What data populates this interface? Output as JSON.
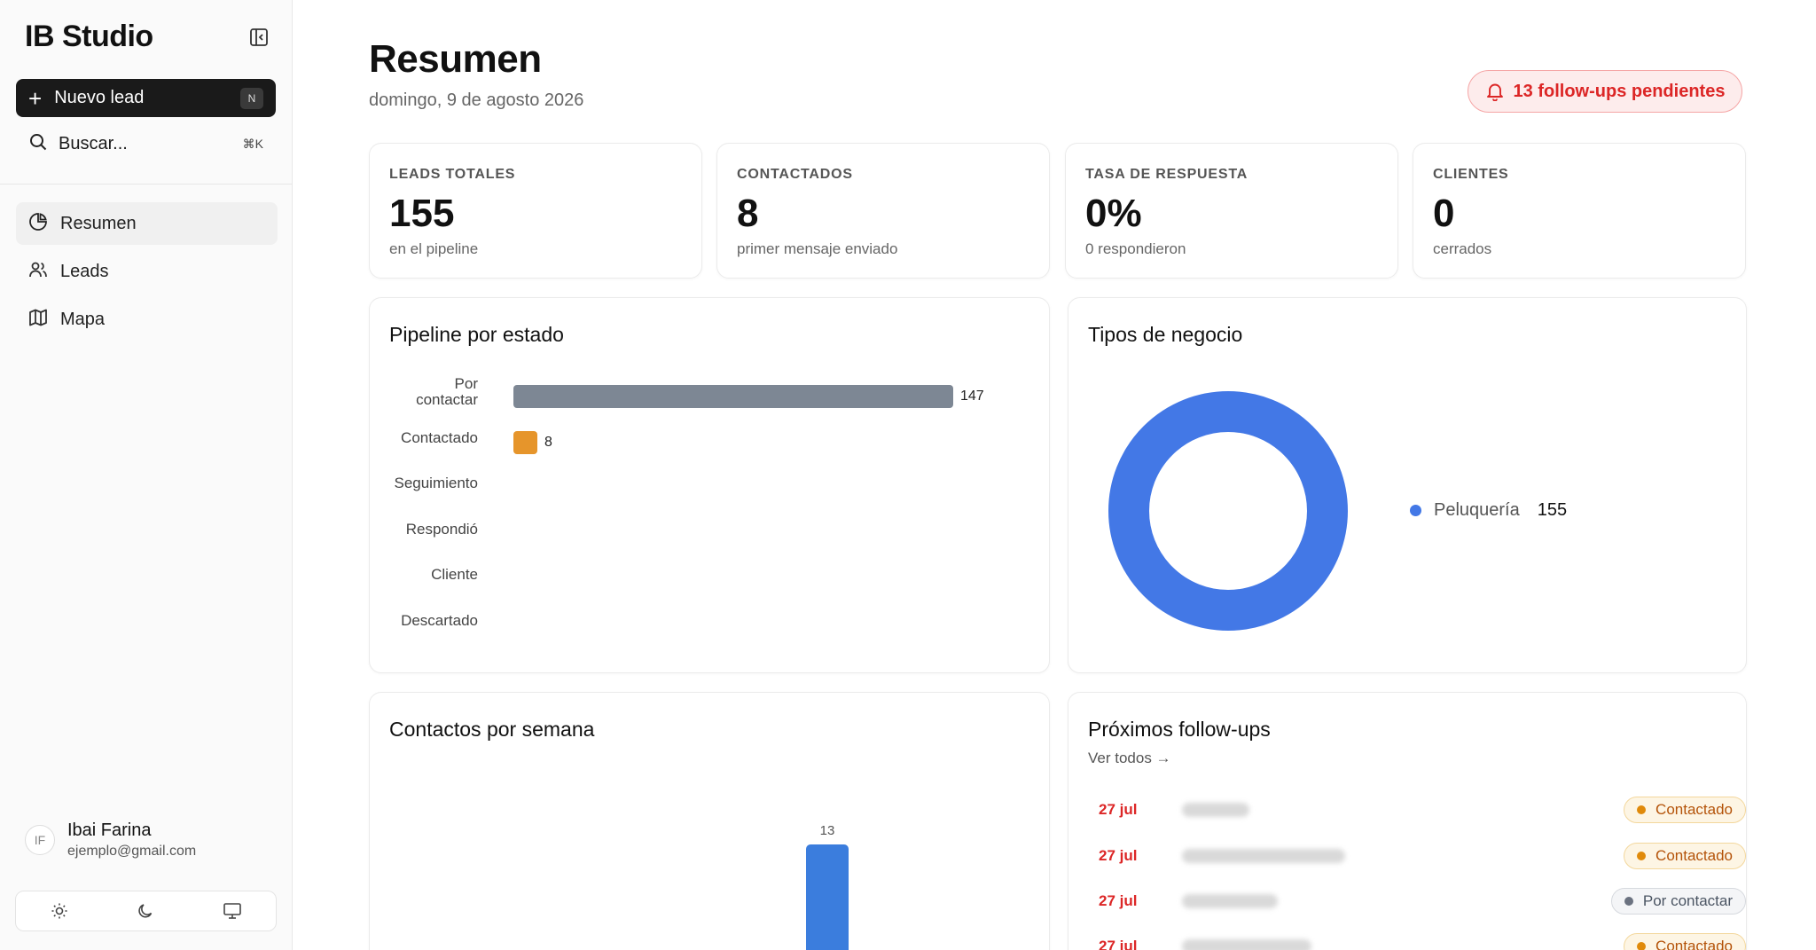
{
  "sidebar": {
    "brand": "IB Studio",
    "new_lead": {
      "label": "Nuevo lead",
      "shortcut": "N"
    },
    "search": {
      "label": "Buscar...",
      "shortcut": "⌘K"
    },
    "nav": [
      {
        "label": "Resumen",
        "icon": "pie-chart-icon",
        "active": true
      },
      {
        "label": "Leads",
        "icon": "users-icon",
        "active": false
      },
      {
        "label": "Mapa",
        "icon": "map-icon",
        "active": false
      }
    ],
    "user": {
      "initials": "IF",
      "name": "Ibai Farina",
      "email": "ejemplo@gmail.com"
    },
    "theme_buttons": [
      "sun-icon",
      "moon-icon",
      "monitor-icon"
    ]
  },
  "header": {
    "title": "Resumen",
    "date": "domingo, 9 de agosto 2026",
    "followups_alert": "13 follow-ups pendientes"
  },
  "stats": [
    {
      "label": "LEADS TOTALES",
      "value": "155",
      "sub": "en el pipeline"
    },
    {
      "label": "CONTACTADOS",
      "value": "8",
      "sub": "primer mensaje enviado"
    },
    {
      "label": "TASA DE RESPUESTA",
      "value": "0%",
      "sub": "0 respondieron"
    },
    {
      "label": "CLIENTES",
      "value": "0",
      "sub": "cerrados"
    }
  ],
  "pipeline": {
    "title": "Pipeline por estado",
    "chart_data": {
      "type": "bar",
      "orientation": "horizontal",
      "categories": [
        "Por contactar",
        "Contactado",
        "Seguimiento",
        "Respondió",
        "Cliente",
        "Descartado"
      ],
      "labels_display": [
        [
          "Por",
          "contactar"
        ],
        [
          "Contactado"
        ],
        [
          "Seguimiento"
        ],
        [
          "Respondió"
        ],
        [
          "Cliente"
        ],
        [
          "Descartado"
        ]
      ],
      "values": [
        147,
        8,
        0,
        0,
        0,
        0
      ],
      "colors": [
        "#7d8794",
        "#e6952b",
        "#cccccc",
        "#cccccc",
        "#cccccc",
        "#cccccc"
      ],
      "xlim": [
        0,
        147
      ]
    }
  },
  "business_types": {
    "title": "Tipos de negocio",
    "chart_data": {
      "type": "pie",
      "style": "donut",
      "categories": [
        "Peluquería"
      ],
      "values": [
        155
      ],
      "colors": [
        "#4378e6"
      ],
      "legend": "right"
    }
  },
  "weekly": {
    "title": "Contactos por semana",
    "chart_data": {
      "type": "bar",
      "categories": [
        ""
      ],
      "values": [
        13
      ],
      "colors": [
        "#3b7ddd"
      ],
      "ylim": [
        0,
        13
      ]
    }
  },
  "followups": {
    "title": "Próximos follow-ups",
    "see_all": "Ver todos →",
    "rows": [
      {
        "date": "27 jul",
        "status": "Contactado",
        "status_type": "contactado"
      },
      {
        "date": "27 jul",
        "status": "Contactado",
        "status_type": "contactado"
      },
      {
        "date": "27 jul",
        "status": "Por contactar",
        "status_type": "porcontactar"
      },
      {
        "date": "27 jul",
        "status": "Contactado",
        "status_type": "contactado"
      }
    ]
  }
}
